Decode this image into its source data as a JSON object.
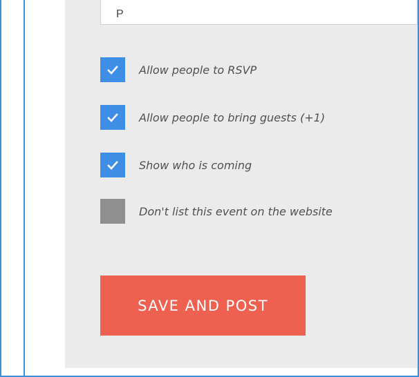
{
  "form": {
    "text_value": "P",
    "options": [
      {
        "label": "Allow people to RSVP",
        "checked": true
      },
      {
        "label": "Allow people to bring guests (+1)",
        "checked": true
      },
      {
        "label": "Show who is coming",
        "checked": true
      },
      {
        "label": "Don't list this event on the website",
        "checked": false
      }
    ],
    "save_label": "SAVE AND POST"
  },
  "colors": {
    "frame_blue": "#3e8fd8",
    "checkbox_checked": "#3f8ee6",
    "checkbox_unchecked": "#8f8f8f",
    "panel_background": "#ebebeb",
    "button_background": "#ee6150"
  },
  "icons": {
    "checked": "check-icon"
  }
}
